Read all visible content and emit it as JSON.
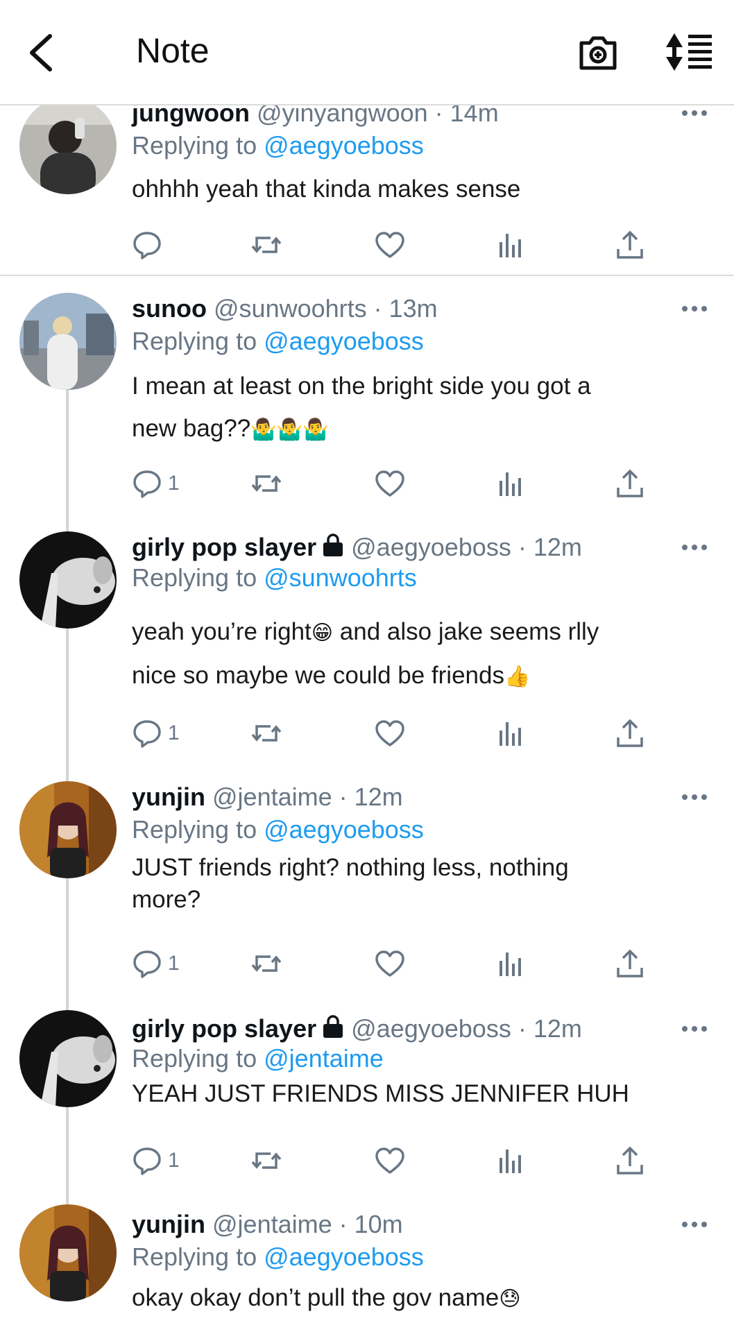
{
  "header": {
    "title": "Note",
    "back_icon": "back-chevron-icon",
    "camera_icon": "camera-icon",
    "sort_icon": "sort-icon"
  },
  "colors": {
    "link": "#1d9bf0",
    "secondary": "#687684",
    "divider": "#dcdcdc"
  },
  "posts": [
    {
      "name": "jungwoon",
      "handle": "@yinyangwoon · 14m",
      "reply_prefix": "Replying to ",
      "mention": "@aegyoeboss",
      "text_lines": [
        "ohhhh yeah that kinda makes sense"
      ],
      "reply_count": ""
    },
    {
      "name": "sunoo",
      "handle": "@sunwoohrts · 13m",
      "reply_prefix": "Replying to ",
      "mention": "@aegyoeboss",
      "text_lines": [
        "I mean at least on the bright side you got a",
        "new bag??"
      ],
      "emoji_after": "🤷‍♂️🤷‍♂️🤷‍♂️",
      "reply_count": "1"
    },
    {
      "name": "girly pop slayer",
      "lock_icon": "lock-icon",
      "handle": "@aegyoeboss · 12m",
      "reply_prefix": "Replying to ",
      "mention": "@sunwoohrts",
      "text_lines": [
        "yeah you’re right",
        " and also jake seems rlly",
        "nice so maybe we could be friends"
      ],
      "emoji_1": "😁",
      "emoji_2": "👍",
      "reply_count": "1"
    },
    {
      "name": "yunjin",
      "handle": "@jentaime · 12m",
      "reply_prefix": "Replying to ",
      "mention": "@aegyoeboss",
      "text_lines": [
        "JUST friends right? nothing less, nothing",
        "more?"
      ],
      "reply_count": "1"
    },
    {
      "name": "girly pop slayer",
      "lock_icon": "lock-icon",
      "handle": "@aegyoeboss · 12m",
      "reply_prefix": "Replying to ",
      "mention": "@jentaime",
      "text_lines": [
        "YEAH JUST FRIENDS MISS JENNIFER HUH"
      ],
      "reply_count": "1"
    },
    {
      "name": "yunjin",
      "handle": "@jentaime · 10m",
      "reply_prefix": "Replying to ",
      "mention": "@aegyoeboss",
      "text_lines": [
        "okay okay don’t pull the gov name"
      ],
      "emoji_after": "😓",
      "reply_count": ""
    }
  ]
}
